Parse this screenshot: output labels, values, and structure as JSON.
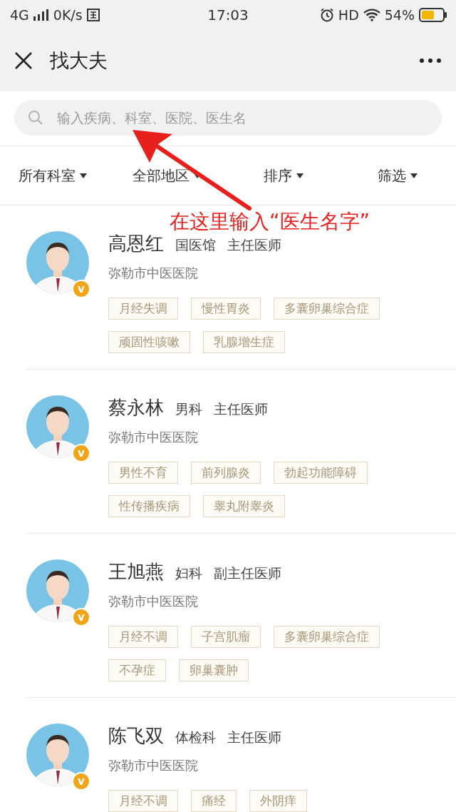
{
  "status_bar": {
    "network": "4G",
    "speed": "0K/s",
    "time": "17:03",
    "hd": "HD",
    "battery": "54%"
  },
  "nav": {
    "title": "找大夫"
  },
  "search": {
    "placeholder": "输入疾病、科室、医院、医生名"
  },
  "filters": [
    {
      "label": "所有科室"
    },
    {
      "label": "全部地区"
    },
    {
      "label": "排序"
    },
    {
      "label": "筛选"
    }
  ],
  "annotation": {
    "text": "在这里输入“医生名字”"
  },
  "doctors": [
    {
      "name": "高恩红",
      "department": "国医馆",
      "title": "主任医师",
      "hospital": "弥勒市中医医院",
      "badge": "v",
      "tags": [
        "月经失调",
        "慢性胃炎",
        "多囊卵巢综合症",
        "顽固性咳嗽",
        "乳腺增生症"
      ]
    },
    {
      "name": "蔡永林",
      "department": "男科",
      "title": "主任医师",
      "hospital": "弥勒市中医医院",
      "badge": "v",
      "tags": [
        "男性不育",
        "前列腺炎",
        "勃起功能障碍",
        "性传播疾病",
        "睾丸附睾炎"
      ]
    },
    {
      "name": "王旭燕",
      "department": "妇科",
      "title": "副主任医师",
      "hospital": "弥勒市中医医院",
      "badge": "v",
      "tags": [
        "月经不调",
        "子宫肌瘤",
        "多囊卵巢综合症",
        "不孕症",
        "卵巢囊肿"
      ]
    },
    {
      "name": "陈飞双",
      "department": "体检科",
      "title": "主任医师",
      "hospital": "弥勒市中医医院",
      "badge": "v",
      "tags": [
        "月经不调",
        "痛经",
        "外阴痒"
      ]
    }
  ]
}
